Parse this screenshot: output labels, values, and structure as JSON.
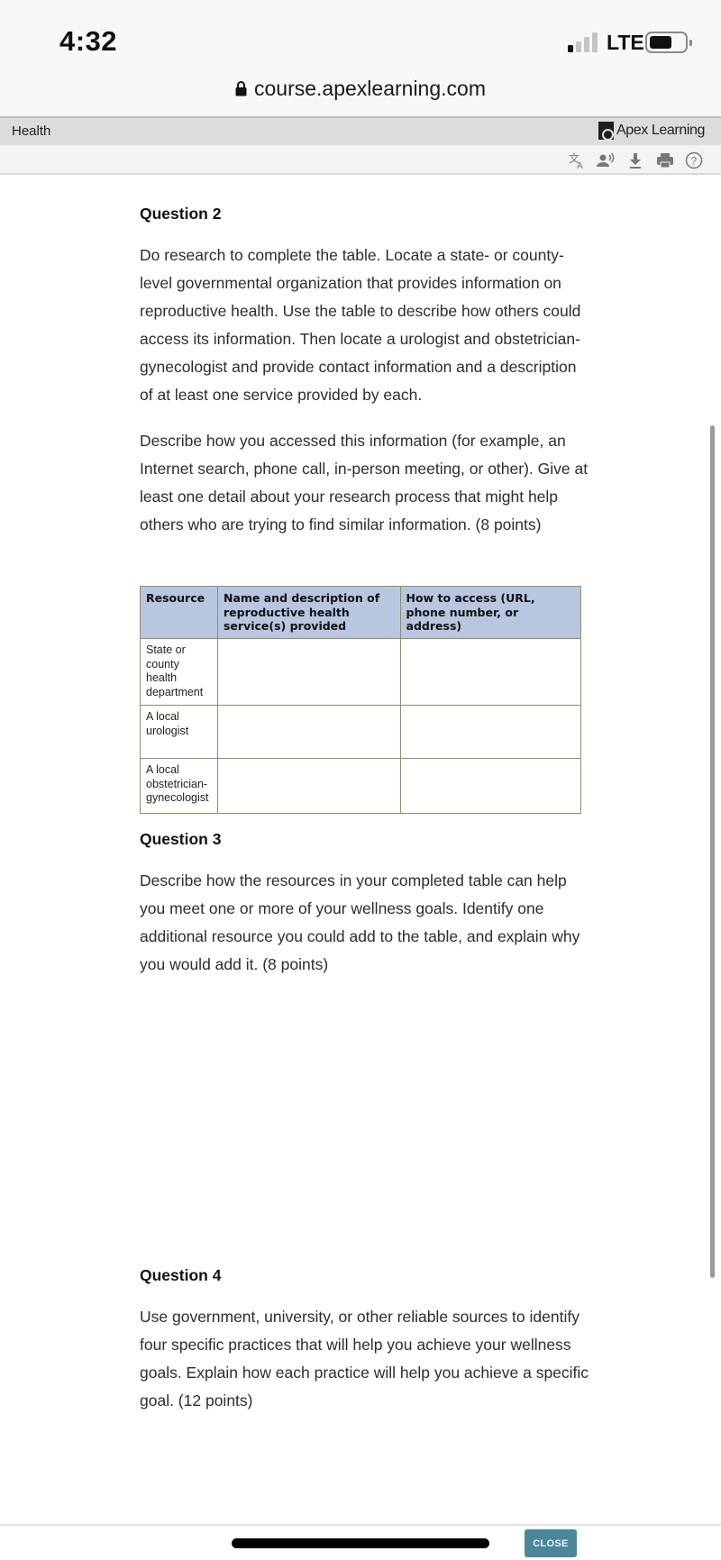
{
  "status_bar": {
    "time": "4:32",
    "network": "LTE",
    "signal_bars_active": 1,
    "signal_bars_total": 4
  },
  "browser": {
    "url": "course.apexlearning.com",
    "lock_icon": "lock-icon"
  },
  "header": {
    "course_title": "Health",
    "brand_name": "Apex Learning",
    "brand_logo": "apex-learning-logo"
  },
  "toolbar": {
    "icons": [
      "translate-icon",
      "text-to-speech-icon",
      "download-icon",
      "print-icon",
      "help-icon"
    ]
  },
  "questions": [
    {
      "heading": "Question 2",
      "paragraphs": [
        "Do research to complete the table. Locate a state- or county-level governmental organization that provides information on reproductive health. Use the table to describe how others could access its information. Then locate a urologist and obstetrician-gynecologist and provide contact information and a description of at least one service provided by each.",
        "Describe how you accessed this information (for example, an Internet search, phone call, in-person meeting, or other). Give at least one detail about your research process that might help others who are trying to find similar information. (8 points)"
      ]
    },
    {
      "heading": "Question 3",
      "paragraphs": [
        "Describe how the resources in your completed table can help you meet one or more of your wellness goals. Identify one additional resource you could add to the table, and explain why you would add it. (8 points)"
      ]
    },
    {
      "heading": "Question 4",
      "paragraphs": [
        "Use government, university, or other reliable sources to identify four specific practices that will help you achieve your wellness goals. Explain how each practice will help you achieve a specific goal. (12 points)"
      ]
    }
  ],
  "table": {
    "headers": [
      "Resource",
      "Name and description of reproductive health service(s) provided",
      "How to access (URL, phone number, or address)"
    ],
    "rows": [
      [
        "State or county health department",
        "",
        ""
      ],
      [
        "A local urologist",
        "",
        ""
      ],
      [
        "A local obstetrician-gynecologist",
        "",
        ""
      ]
    ],
    "header_color": "#b8c6e0"
  },
  "footer": {
    "close_label": "CLOSE",
    "close_color": "#4a8799"
  }
}
